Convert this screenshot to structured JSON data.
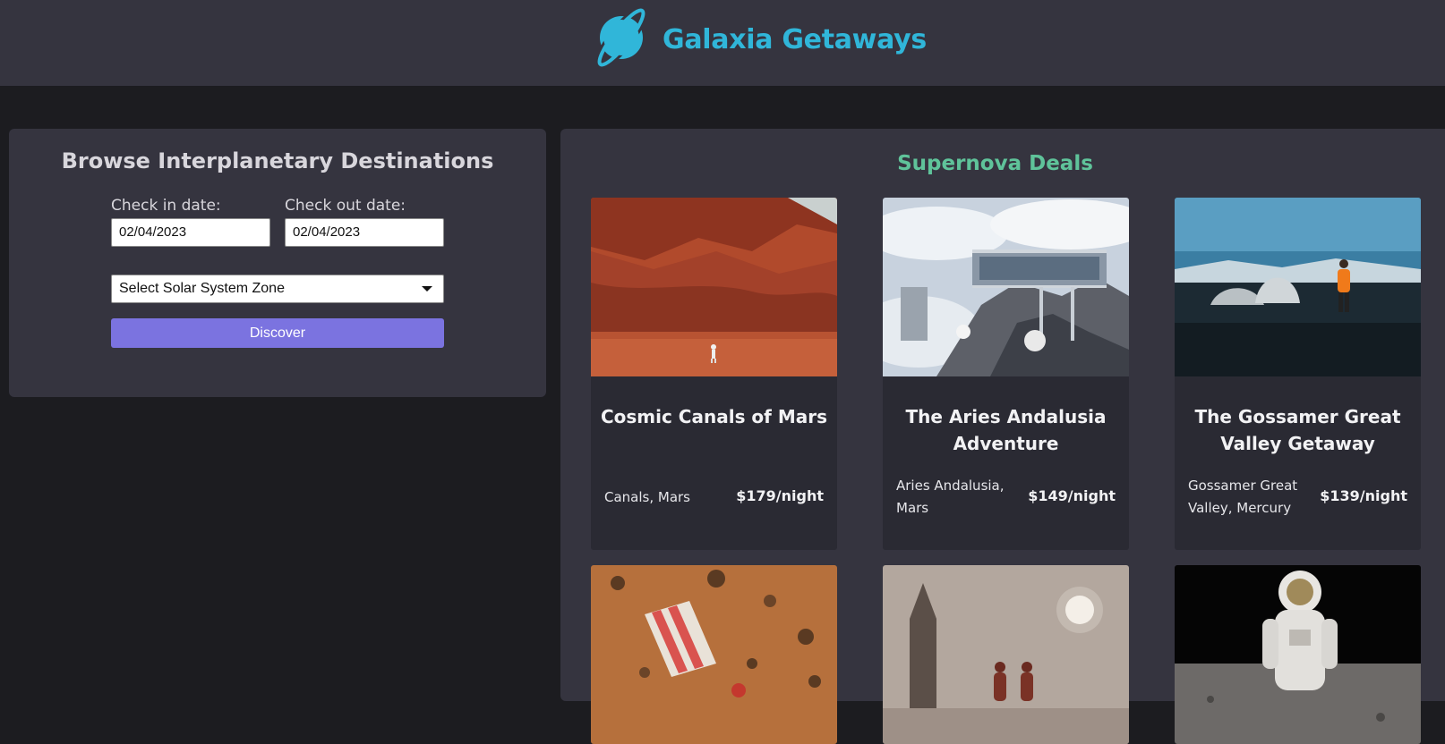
{
  "header": {
    "brand": "Galaxia Getaways",
    "logo_icon": "planet-icon",
    "brand_color": "#30b6d9",
    "bar_color": "#35343f"
  },
  "search": {
    "title": "Browse Interplanetary Destinations",
    "check_in_label": "Check in date:",
    "check_in_value": "02/04/2023",
    "check_out_label": "Check out date:",
    "check_out_value": "02/04/2023",
    "zone_selected": "Select Solar System Zone",
    "discover_label": "Discover",
    "button_color": "#7b73e0"
  },
  "deals": {
    "title": "Supernova Deals",
    "title_color": "#5fc39a",
    "cards": [
      {
        "name": "Cosmic Canals of Mars",
        "location": "Canals, Mars",
        "price": "$179/night",
        "image": "mars-canyon-photo"
      },
      {
        "name": "The Aries Andalusia Adventure",
        "location": "Aries Andalusia, Mars",
        "price": "$149/night",
        "image": "mountain-station-photo"
      },
      {
        "name": "The Gossamer Great Valley Getaway",
        "location": "Gossamer Great Valley, Mercury",
        "price": "$139/night",
        "image": "valley-explorer-photo"
      },
      {
        "image": "mars-deckchair-photo"
      },
      {
        "image": "rocket-silhouettes-photo"
      },
      {
        "image": "astronaut-moon-photo"
      }
    ]
  }
}
